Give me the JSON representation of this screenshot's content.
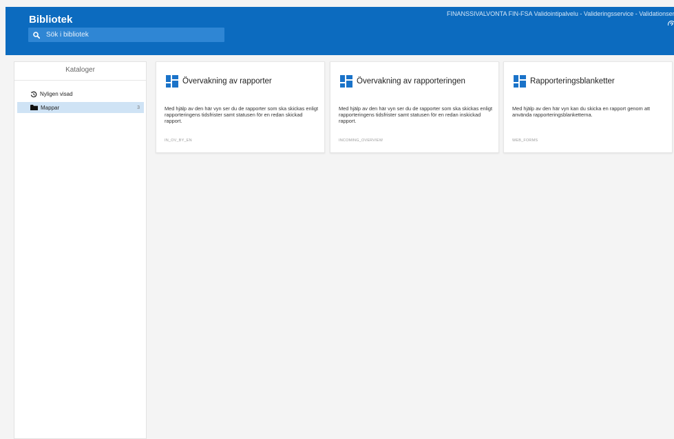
{
  "header": {
    "title": "Bibliotek",
    "tenant": "FINANSSIVALVONTA FIN-FSA Validointipalvelu - Valideringsservice - Validationservice",
    "help_icon": "help-circle-icon",
    "brand_color": "#0c6bbf"
  },
  "search": {
    "placeholder": "Sök i bibliotek",
    "icon": "search-icon"
  },
  "sidebar": {
    "header": "Kataloger",
    "items": [
      {
        "label": "Nyligen visad",
        "icon": "history-icon"
      },
      {
        "label": "Mappar",
        "icon": "folder-icon",
        "count": "3",
        "selected": true
      }
    ]
  },
  "cards": [
    {
      "title": "Övervakning av rapporter",
      "description": "Med hjälp av den här vyn ser du de rapporter som ska skickas enligt rapporteringens tidsfrister samt statusen för en redan skickad rapport.",
      "code": "IN_OV_BY_EN",
      "icon": "dashboard-icon"
    },
    {
      "title": "Övervakning av rapporteringen",
      "description": "Med hjälp av den här vyn ser du de rapporter som ska skickas enligt rapporteringens tidsfrister samt statusen för en redan inskickad rapport.",
      "code": "INCOMING_OVERVIEW",
      "icon": "dashboard-icon"
    },
    {
      "title": "Rapporteringsblanketter",
      "description": "Med hjälp av den här vyn kan du skicka en rapport genom att använda rapporteringsblanketterna.",
      "code": "WEB_FORMS",
      "icon": "dashboard-icon"
    }
  ]
}
